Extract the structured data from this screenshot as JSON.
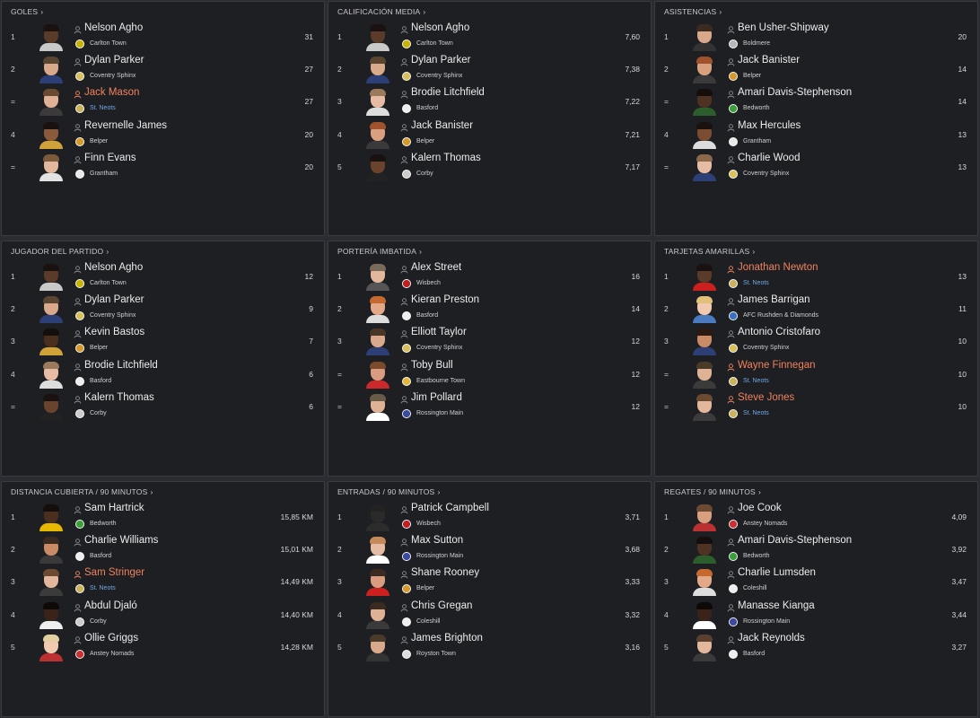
{
  "panels": [
    {
      "title": "GOLES",
      "rows": [
        {
          "rank": "1",
          "name": "Nelson Agho",
          "club": "Carlton Town",
          "value": "31",
          "hl": false,
          "skin": "#5a3a28",
          "hair": "#1a1210",
          "shirt": "#c9c9c9",
          "crest": "#c8b400"
        },
        {
          "rank": "2",
          "name": "Dylan Parker",
          "club": "Coventry Sphinx",
          "value": "27",
          "hl": false,
          "skin": "#d9a98c",
          "hair": "#5a4630",
          "shirt": "#2d3f77",
          "crest": "#d8c15a"
        },
        {
          "rank": "=",
          "name": "Jack Mason",
          "club": "St. Neots",
          "value": "27",
          "hl": true,
          "skin": "#e0b295",
          "hair": "#6a4a30",
          "shirt": "#3b3b3b",
          "crest": "#c9b45c"
        },
        {
          "rank": "4",
          "name": "Revernelle James",
          "club": "Belper",
          "value": "20",
          "hl": false,
          "skin": "#8a5a3c",
          "hair": "#1a1210",
          "shirt": "#cfa33a",
          "crest": "#d49a2a"
        },
        {
          "rank": "=",
          "name": "Finn Evans",
          "club": "Grantham",
          "value": "20",
          "hl": false,
          "skin": "#e3b79b",
          "hair": "#7a5a3a",
          "shirt": "#e3e3e3",
          "crest": "#e8e8e8"
        }
      ]
    },
    {
      "title": "CALIFICACIÓN MEDIA",
      "rows": [
        {
          "rank": "1",
          "name": "Nelson Agho",
          "club": "Carlton Town",
          "value": "7,60",
          "hl": false,
          "skin": "#5a3a28",
          "hair": "#1a1210",
          "shirt": "#c9c9c9",
          "crest": "#c8b400"
        },
        {
          "rank": "2",
          "name": "Dylan Parker",
          "club": "Coventry Sphinx",
          "value": "7,38",
          "hl": false,
          "skin": "#d9a98c",
          "hair": "#5a4630",
          "shirt": "#2d3f77",
          "crest": "#d8c15a"
        },
        {
          "rank": "3",
          "name": "Brodie Litchfield",
          "club": "Basford",
          "value": "7,22",
          "hl": false,
          "skin": "#e6bda4",
          "hair": "#9a7a5a",
          "shirt": "#dddddd",
          "crest": "#eeeeee"
        },
        {
          "rank": "4",
          "name": "Jack Banister",
          "club": "Belper",
          "value": "7,21",
          "hl": false,
          "skin": "#d9a080",
          "hair": "#a0522d",
          "shirt": "#3a3a3a",
          "crest": "#d49a2a"
        },
        {
          "rank": "5",
          "name": "Kalern Thomas",
          "club": "Corby",
          "value": "7,17",
          "hl": false,
          "skin": "#6a432c",
          "hair": "#1a1210",
          "shirt": "#222222",
          "crest": "#cccccc"
        }
      ]
    },
    {
      "title": "ASISTENCIAS",
      "rows": [
        {
          "rank": "1",
          "name": "Ben Usher-Shipway",
          "club": "Boldmere",
          "value": "20",
          "hl": false,
          "skin": "#d9a88a",
          "hair": "#3a2a20",
          "shirt": "#333333",
          "crest": "#b8b8b8"
        },
        {
          "rank": "2",
          "name": "Jack Banister",
          "club": "Belper",
          "value": "14",
          "hl": false,
          "skin": "#d9a080",
          "hair": "#a0522d",
          "shirt": "#3a3a3a",
          "crest": "#d49a2a"
        },
        {
          "rank": "=",
          "name": "Amari Davis-Stephenson",
          "club": "Bedworth",
          "value": "14",
          "hl": false,
          "skin": "#4e3222",
          "hair": "#140e0c",
          "shirt": "#2c5d2c",
          "crest": "#3aa03a"
        },
        {
          "rank": "4",
          "name": "Max Hercules",
          "club": "Grantham",
          "value": "13",
          "hl": false,
          "skin": "#7a4c30",
          "hair": "#1a1210",
          "shirt": "#dddddd",
          "crest": "#e8e8e8"
        },
        {
          "rank": "=",
          "name": "Charlie Wood",
          "club": "Coventry Sphinx",
          "value": "13",
          "hl": false,
          "skin": "#e6bda4",
          "hair": "#8a6a4a",
          "shirt": "#2d3f77",
          "crest": "#d8c15a"
        }
      ]
    },
    {
      "title": "JUGADOR DEL PARTIDO",
      "rows": [
        {
          "rank": "1",
          "name": "Nelson Agho",
          "club": "Carlton Town",
          "value": "12",
          "hl": false,
          "skin": "#5a3a28",
          "hair": "#1a1210",
          "shirt": "#c9c9c9",
          "crest": "#c8b400"
        },
        {
          "rank": "2",
          "name": "Dylan Parker",
          "club": "Coventry Sphinx",
          "value": "9",
          "hl": false,
          "skin": "#d9a98c",
          "hair": "#5a4630",
          "shirt": "#2d3f77",
          "crest": "#d8c15a"
        },
        {
          "rank": "3",
          "name": "Kevin Bastos",
          "club": "Belper",
          "value": "7",
          "hl": false,
          "skin": "#4a2e1e",
          "hair": "#140e0c",
          "shirt": "#cfa33a",
          "crest": "#d49a2a"
        },
        {
          "rank": "4",
          "name": "Brodie Litchfield",
          "club": "Basford",
          "value": "6",
          "hl": false,
          "skin": "#e6bda4",
          "hair": "#9a7a5a",
          "shirt": "#dddddd",
          "crest": "#eeeeee"
        },
        {
          "rank": "=",
          "name": "Kalern Thomas",
          "club": "Corby",
          "value": "6",
          "hl": false,
          "skin": "#6a432c",
          "hair": "#1a1210",
          "shirt": "#222222",
          "crest": "#cccccc"
        }
      ]
    },
    {
      "title": "PORTERÍA IMBATIDA",
      "rows": [
        {
          "rank": "1",
          "name": "Alex Street",
          "club": "Wisbech",
          "value": "16",
          "hl": false,
          "skin": "#e3b79b",
          "hair": "#7a6a5a",
          "shirt": "#555555",
          "crest": "#c02020"
        },
        {
          "rank": "2",
          "name": "Kieran Preston",
          "club": "Basford",
          "value": "14",
          "hl": false,
          "skin": "#e2a887",
          "hair": "#c46a30",
          "shirt": "#dddddd",
          "crest": "#eeeeee"
        },
        {
          "rank": "3",
          "name": "Elliott Taylor",
          "club": "Coventry Sphinx",
          "value": "12",
          "hl": false,
          "skin": "#d9a98c",
          "hair": "#4a3626",
          "shirt": "#2d3f77",
          "crest": "#d8c15a"
        },
        {
          "rank": "=",
          "name": "Toby Bull",
          "club": "Eastbourne Town",
          "value": "12",
          "hl": false,
          "skin": "#d99c80",
          "hair": "#7a4a2a",
          "shirt": "#cc2a2a",
          "crest": "#e2b83a"
        },
        {
          "rank": "=",
          "name": "Jim Pollard",
          "club": "Rossington Main",
          "value": "12",
          "hl": false,
          "skin": "#e0b295",
          "hair": "#6a5a4a",
          "shirt": "#ffffff",
          "crest": "#3a4aa0"
        }
      ]
    },
    {
      "title": "TARJETAS AMARILLAS",
      "rows": [
        {
          "rank": "1",
          "name": "Jonathan Newton",
          "club": "St. Neots",
          "value": "13",
          "hl": true,
          "skin": "#5a3a28",
          "hair": "#1a1210",
          "shirt": "#cc2020",
          "crest": "#c9b45c"
        },
        {
          "rank": "2",
          "name": "James Barrigan",
          "club": "AFC Rushden & Diamonds",
          "value": "11",
          "hl": false,
          "skin": "#f0c9ae",
          "hair": "#e2c07a",
          "shirt": "#4a7ac0",
          "crest": "#3a70c0"
        },
        {
          "rank": "3",
          "name": "Antonio Cristofaro",
          "club": "Coventry Sphinx",
          "value": "10",
          "hl": false,
          "skin": "#c98a66",
          "hair": "#2a1a10",
          "shirt": "#2d3f77",
          "crest": "#d8c15a"
        },
        {
          "rank": "=",
          "name": "Wayne Finnegan",
          "club": "St. Neots",
          "value": "10",
          "hl": true,
          "skin": "#e0b295",
          "hair": "#4a3a2a",
          "shirt": "#3b3b3b",
          "crest": "#c9b45c"
        },
        {
          "rank": "=",
          "name": "Steve Jones",
          "club": "St. Neots",
          "value": "10",
          "hl": true,
          "skin": "#e3b79b",
          "hair": "#6a4a30",
          "shirt": "#3b3b3b",
          "crest": "#c9b45c"
        }
      ]
    },
    {
      "title": "DISTANCIA CUBIERTA / 90 MINUTOS",
      "rows": [
        {
          "rank": "1",
          "name": "Sam Hartrick",
          "club": "Bedworth",
          "value": "15,85 KM",
          "hl": false,
          "skin": "#4a2e1e",
          "hair": "#140e0c",
          "shirt": "#e6b800",
          "crest": "#3aa03a"
        },
        {
          "rank": "2",
          "name": "Charlie Williams",
          "club": "Basford",
          "value": "15,01 KM",
          "hl": false,
          "skin": "#c98a66",
          "hair": "#3a2a20",
          "shirt": "#3a3a3a",
          "crest": "#eeeeee"
        },
        {
          "rank": "3",
          "name": "Sam Stringer",
          "club": "St. Neots",
          "value": "14,49 KM",
          "hl": true,
          "skin": "#e3b79b",
          "hair": "#6a4a30",
          "shirt": "#3b3b3b",
          "crest": "#c9b45c"
        },
        {
          "rank": "4",
          "name": "Abdul Djaló",
          "club": "Corby",
          "value": "14,40 KM",
          "hl": false,
          "skin": "#3a241a",
          "hair": "#0e0a08",
          "shirt": "#eeeeee",
          "crest": "#cccccc"
        },
        {
          "rank": "5",
          "name": "Ollie Griggs",
          "club": "Anstey Nomads",
          "value": "14,28 KM",
          "hl": false,
          "skin": "#f0c9ae",
          "hair": "#e2cfa0",
          "shirt": "#bb3030",
          "crest": "#cc3030"
        }
      ]
    },
    {
      "title": "ENTRADAS / 90 MINUTOS",
      "rows": [
        {
          "rank": "1",
          "name": "Patrick Campbell",
          "club": "Wisbech",
          "value": "3,71",
          "hl": false,
          "skin": "#2a2a2a",
          "hair": "#222222",
          "shirt": "#2c2c2c",
          "crest": "#c02020"
        },
        {
          "rank": "2",
          "name": "Max Sutton",
          "club": "Rossington Main",
          "value": "3,68",
          "hl": false,
          "skin": "#e6bda4",
          "hair": "#c48a5a",
          "shirt": "#ffffff",
          "crest": "#3a4aa0"
        },
        {
          "rank": "3",
          "name": "Shane Rooney",
          "club": "Belper",
          "value": "3,33",
          "hl": false,
          "skin": "#d99c80",
          "hair": "#3a2a20",
          "shirt": "#cc2020",
          "crest": "#d49a2a"
        },
        {
          "rank": "4",
          "name": "Chris Gregan",
          "club": "Coleshill",
          "value": "3,32",
          "hl": false,
          "skin": "#e0b295",
          "hair": "#3a2a20",
          "shirt": "#3a3a3a",
          "crest": "#eeeeee"
        },
        {
          "rank": "5",
          "name": "James Brighton",
          "club": "Royston Town",
          "value": "3,16",
          "hl": false,
          "skin": "#d9a98c",
          "hair": "#4a3a2a",
          "shirt": "#333333",
          "crest": "#dddddd"
        }
      ]
    },
    {
      "title": "REGATES / 90 MINUTOS",
      "rows": [
        {
          "rank": "1",
          "name": "Joe Cook",
          "club": "Anstey Nomads",
          "value": "4,09",
          "hl": false,
          "skin": "#d9a080",
          "hair": "#6a4a30",
          "shirt": "#bb3030",
          "crest": "#cc3030"
        },
        {
          "rank": "2",
          "name": "Amari Davis-Stephenson",
          "club": "Bedworth",
          "value": "3,92",
          "hl": false,
          "skin": "#4e3222",
          "hair": "#140e0c",
          "shirt": "#2c5d2c",
          "crest": "#3aa03a"
        },
        {
          "rank": "3",
          "name": "Charlie Lumsden",
          "club": "Coleshill",
          "value": "3,47",
          "hl": false,
          "skin": "#e2a887",
          "hair": "#c46a30",
          "shirt": "#dddddd",
          "crest": "#eeeeee"
        },
        {
          "rank": "4",
          "name": "Manasse Kianga",
          "club": "Rossington Main",
          "value": "3,44",
          "hl": false,
          "skin": "#3a241a",
          "hair": "#0e0a08",
          "shirt": "#ffffff",
          "crest": "#3a4aa0"
        },
        {
          "rank": "5",
          "name": "Jack Reynolds",
          "club": "Basford",
          "value": "3,27",
          "hl": false,
          "skin": "#e3b79b",
          "hair": "#5a4030",
          "shirt": "#3a3a3a",
          "crest": "#eeeeee"
        }
      ]
    }
  ],
  "colors": {
    "highlight_name": "#f0825e",
    "highlight_club": "#6fa8e6",
    "panel_bg": "#1e1f23"
  }
}
